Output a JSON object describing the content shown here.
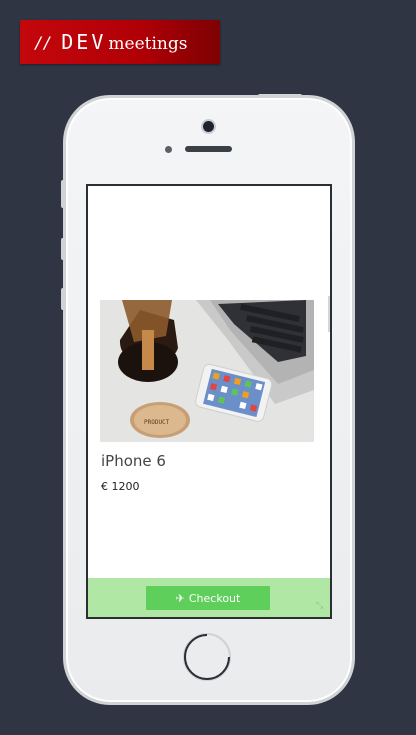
{
  "logo": {
    "slashes": "//",
    "dev": "DEV",
    "meetings": "meetings"
  },
  "product": {
    "name": "iPhone 6",
    "price": "€ 1200"
  },
  "checkout": {
    "icon": "plane-icon",
    "label": "Checkout",
    "icon_glyph": "✈"
  },
  "colors": {
    "background": "#2f3542",
    "logo_red": "#c4070c",
    "checkout_bar": "#b1e7a5",
    "checkout_button": "#5ecf5a"
  }
}
